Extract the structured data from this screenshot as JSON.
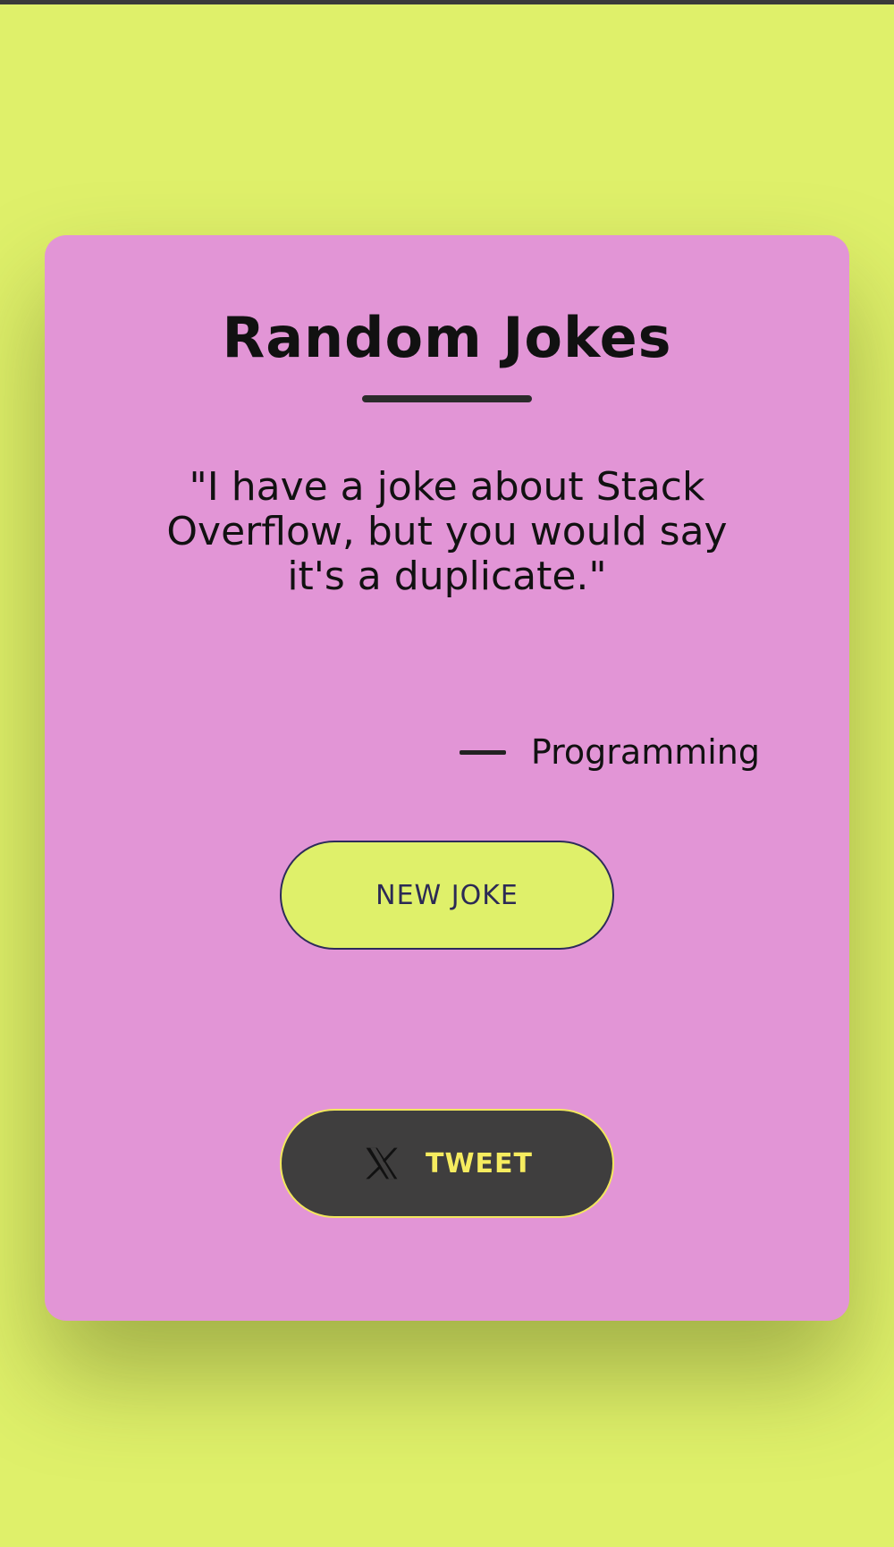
{
  "app": {
    "title": "Random Jokes"
  },
  "joke": {
    "text": "\"I have a joke about Stack Overflow, but you would say it's a duplicate.\"",
    "category": "Programming"
  },
  "buttons": {
    "new_joke_label": "NEW JOKE",
    "tweet_label": "TWEET",
    "tweet_icon": "x-logo-icon"
  },
  "colors": {
    "background": "#dff06a",
    "card": "#e295d6",
    "tweet_button": "#3f3e3e",
    "tweet_text": "#f6ec5f",
    "new_joke_border": "#2d2b5a"
  }
}
